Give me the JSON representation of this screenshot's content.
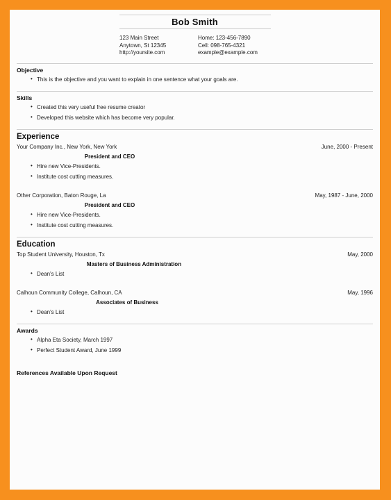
{
  "theme": {
    "frame_color": "#F7901E",
    "page_color": "#FCFCFC",
    "rule_color": "#CFCFCF",
    "text_color": "#222222"
  },
  "header": {
    "name": "Bob Smith",
    "contact_left": [
      "123 Main Street",
      "Anytown, St 12345",
      "http://yoursite.com"
    ],
    "contact_right": [
      "Home: 123-456-7890",
      "Cell: 098-765-4321",
      "example@example.com"
    ]
  },
  "objective": {
    "title": "Objective",
    "items": [
      "This is the objective and you want to explain in one sentence what your goals are."
    ]
  },
  "skills": {
    "title": "Skills",
    "items": [
      "Created this very useful free resume creator",
      "Developed this website which has become very popular."
    ]
  },
  "experience": {
    "title": "Experience",
    "entries": [
      {
        "org": "Your Company Inc., New York, New York",
        "date": "June, 2000 - Present",
        "role": "President and CEO",
        "items": [
          "Hire new Vice-Presidents.",
          "Institute cost cutting measures."
        ]
      },
      {
        "org": "Other Corporation, Baton Rouge, La",
        "date": "May, 1987 - June, 2000",
        "role": "President and CEO",
        "items": [
          "Hire new Vice-Presidents.",
          "Institute cost cutting measures."
        ]
      }
    ]
  },
  "education": {
    "title": "Education",
    "entries": [
      {
        "org": "Top Student University, Houston, Tx",
        "date": "May, 2000",
        "role": "Masters of Business Administration",
        "items": [
          "Dean's List"
        ]
      },
      {
        "org": "Calhoun Community College, Calhoun, CA",
        "date": "May, 1996",
        "role": "Associates of Business",
        "items": [
          "Dean's List"
        ]
      }
    ]
  },
  "awards": {
    "title": "Awards",
    "items": [
      "Alpha Eta Society, March 1997",
      "Perfect Student Award, June 1999"
    ]
  },
  "references": {
    "text": "References Available Upon Request"
  }
}
